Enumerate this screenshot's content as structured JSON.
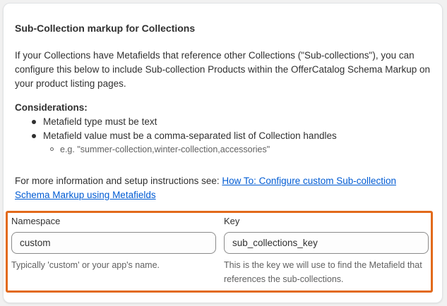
{
  "card": {
    "title": "Sub-Collection markup for Collections",
    "intro": "If your Collections have Metafields that reference other Collections (\"Sub-collections\"), you can configure this below to include Sub-collection Products within the OfferCatalog Schema Markup on your product listing pages.",
    "considerations_heading": "Considerations:",
    "considerations": [
      "Metafield type must be text",
      "Metafield value must be a comma-separated list of Collection handles"
    ],
    "example": "e.g. \"summer-collection,winter-collection,accessories\"",
    "more_info_prefix": "For more information and setup instructions see: ",
    "more_info_link": "How To: Configure custom Sub-collection Schema Markup using Metafields"
  },
  "fields": {
    "namespace": {
      "label": "Namespace",
      "value": "custom",
      "help": "Typically 'custom' or your app's name."
    },
    "key": {
      "label": "Key",
      "value": "sub_collections_key",
      "help": "This is the key we will use to find the Metafield that references the sub-collections."
    }
  },
  "colors": {
    "highlight_border": "#e26a1b",
    "link": "#005bd3"
  }
}
